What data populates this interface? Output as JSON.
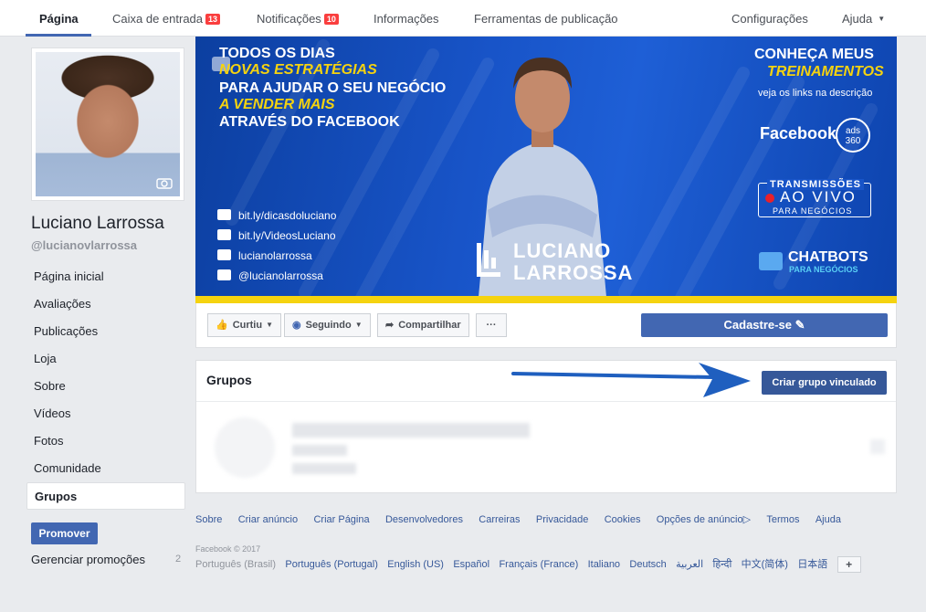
{
  "topnav": {
    "page": "Página",
    "inbox": "Caixa de entrada",
    "inbox_count": "13",
    "notifications": "Notificações",
    "notifications_count": "10",
    "info": "Informações",
    "publishing_tools": "Ferramentas de publicação",
    "settings": "Configurações",
    "help": "Ajuda"
  },
  "profile": {
    "name": "Luciano Larrossa",
    "handle": "@lucianovlarrossa"
  },
  "sidebar": {
    "items": [
      {
        "label": "Página inicial"
      },
      {
        "label": "Avaliações"
      },
      {
        "label": "Publicações"
      },
      {
        "label": "Loja"
      },
      {
        "label": "Sobre"
      },
      {
        "label": "Vídeos"
      },
      {
        "label": "Fotos"
      },
      {
        "label": "Comunidade"
      },
      {
        "label": "Grupos"
      }
    ],
    "promote_button": "Promover",
    "manage_promotions": "Gerenciar promoções",
    "manage_promotions_count": "2"
  },
  "cover": {
    "line1": "TODOS OS DIAS",
    "line2": "NOVAS ESTRATÉGIAS",
    "line3": "PARA AJUDAR O SEU NEGÓCIO",
    "line4": "A VENDER MAIS",
    "line5": "ATRAVÉS DO FACEBOOK",
    "links": [
      "bit.ly/dicasdoluciano",
      "bit.ly/VideosLuciano",
      "lucianolarrossa",
      "@lucianolarrossa"
    ],
    "brand_first": "LUCIANO",
    "brand_last": "LARROSSA",
    "right_title1": "CONHEÇA MEUS",
    "right_title2": "TREINAMENTOS",
    "right_sub": "veja os links na descrição",
    "facebook_ads": "Facebook",
    "ads_badge": "ads 360",
    "live1": "TRANSMISSÕES",
    "live2": "AO VIVO",
    "live3": "PARA NEGÓCIOS",
    "chatbots": "CHATBOTS",
    "chatbots_sub": "PARA NEGÓCIOS",
    "colors": {
      "blue": "#1854c8",
      "yellow": "#f5d30f"
    }
  },
  "actions": {
    "like": "Curtiu",
    "following": "Seguindo",
    "share": "Compartilhar",
    "more": "···",
    "signup": "Cadastre-se"
  },
  "groups": {
    "title": "Grupos",
    "create_button": "Criar grupo vinculado"
  },
  "footer": {
    "links": [
      "Sobre",
      "Criar anúncio",
      "Criar Página",
      "Desenvolvedores",
      "Carreiras",
      "Privacidade",
      "Cookies",
      "Opções de anúncio",
      "Termos",
      "Ajuda"
    ],
    "copyright": "Facebook © 2017",
    "languages": [
      "Português (Brasil)",
      "Português (Portugal)",
      "English (US)",
      "Español",
      "Français (France)",
      "Italiano",
      "Deutsch",
      "العربية",
      "हिन्दी",
      "中文(简体)",
      "日本語"
    ],
    "add_language": "+"
  }
}
